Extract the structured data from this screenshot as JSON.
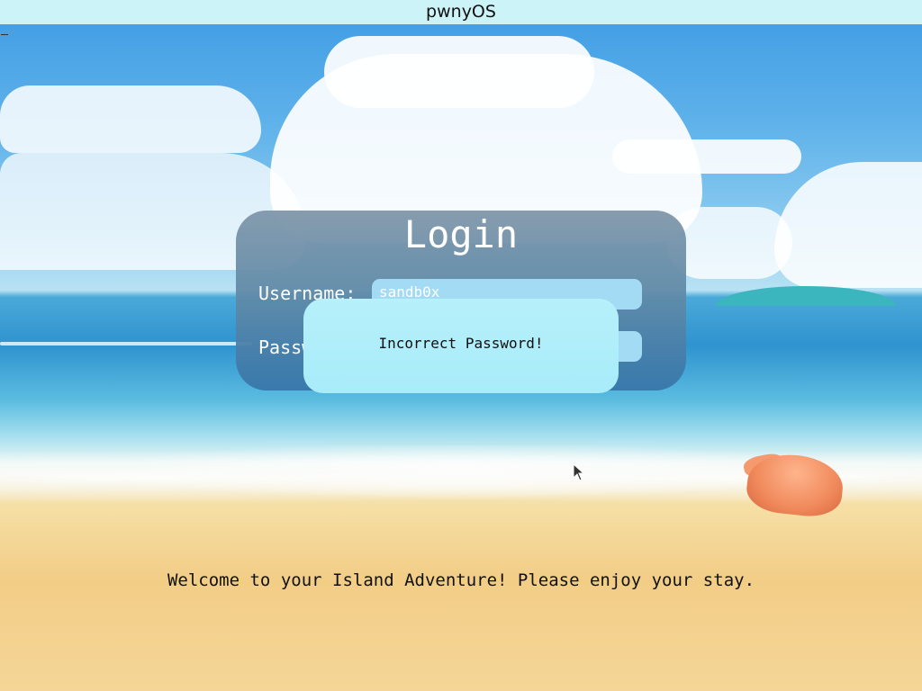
{
  "window": {
    "title": "pwnyOS"
  },
  "login": {
    "title": "Login",
    "username_label": "Username:",
    "username_value": "sandb0x",
    "password_label": "Password:",
    "password_value": ""
  },
  "dialog": {
    "message": "Incorrect Password!"
  },
  "footer": {
    "welcome_text": "Welcome to your Island Adventure! Please enjoy your stay."
  },
  "icons": {
    "cursor": "mouse-pointer-icon",
    "shell": "seashell-icon"
  },
  "colors": {
    "titlebar": "#ccf3f8",
    "panel_top": "#8097aa",
    "panel_bottom": "#3776aa",
    "input_bg": "#a2dbf3",
    "dialog_bg": "#aeeefa"
  }
}
